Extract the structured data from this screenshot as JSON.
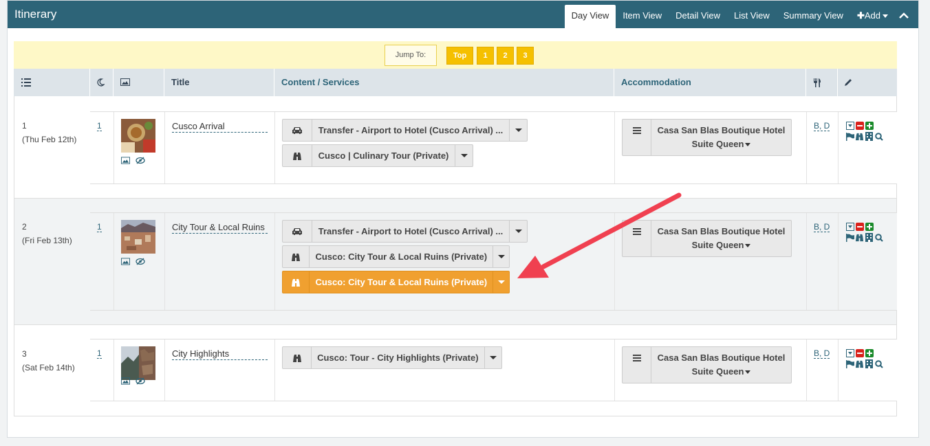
{
  "header": {
    "title": "Itinerary",
    "views": [
      "Day View",
      "Item View",
      "Detail View",
      "List View",
      "Summary View"
    ],
    "active_view": "Day View",
    "add_label": "Add"
  },
  "jump": {
    "label": "Jump To:",
    "buttons": [
      "Top",
      "1",
      "2",
      "3"
    ]
  },
  "columns": {
    "title": "Title",
    "content": "Content / Services",
    "accommodation": "Accommodation"
  },
  "days": [
    {
      "num": "1",
      "date": "(Thu Feb 12th)",
      "nights": "1",
      "title": "Cusco Arrival",
      "services": [
        {
          "label": "Transfer - Airport to Hotel (Cusco Arrival) ...",
          "icon": "car-icon"
        },
        {
          "label": "Cusco | Culinary Tour (Private)",
          "icon": "binoculars-icon"
        }
      ],
      "hotel": "Casa San Blas Boutique Hotel",
      "room": "Suite Queen",
      "meals": "B, D"
    },
    {
      "num": "2",
      "date": "(Fri Feb 13th)",
      "nights": "1",
      "title": "City Tour & Local Ruins",
      "services": [
        {
          "label": "Transfer - Airport to Hotel (Cusco Arrival) ...",
          "icon": "car-icon"
        },
        {
          "label": "Cusco: City Tour & Local Ruins (Private)",
          "icon": "binoculars-icon"
        },
        {
          "label": "Cusco: City Tour & Local Ruins (Private)",
          "icon": "binoculars-icon",
          "highlight": true
        }
      ],
      "hotel": "Casa San Blas Boutique Hotel",
      "room": "Suite Queen",
      "meals": "B, D"
    },
    {
      "num": "3",
      "date": "(Sat Feb 14th)",
      "nights": "1",
      "title": "City Highlights",
      "services": [
        {
          "label": "Cusco: Tour - City Highlights (Private)",
          "icon": "binoculars-icon"
        }
      ],
      "hotel": "Casa San Blas Boutique Hotel",
      "room": "Suite Queen",
      "meals": "B, D"
    }
  ],
  "colors": {
    "header_bg": "#2d6478",
    "jumpbar_bg": "#fef8c7",
    "jump_button": "#f5c000",
    "highlight_service": "#f0a030",
    "arrow": "#f04050"
  }
}
